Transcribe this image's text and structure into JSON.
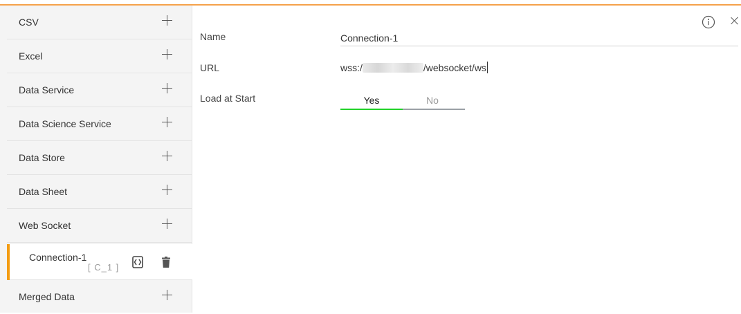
{
  "sidebar": {
    "items": [
      {
        "label": "CSV"
      },
      {
        "label": "Excel"
      },
      {
        "label": "Data Service"
      },
      {
        "label": "Data Science Service"
      },
      {
        "label": "Data Store"
      },
      {
        "label": "Data Sheet"
      },
      {
        "label": "Web Socket"
      }
    ],
    "connection": {
      "name": "Connection-1",
      "id": "[ C_1 ]"
    },
    "merged": {
      "label": "Merged Data"
    }
  },
  "form": {
    "name_label": "Name",
    "name_value": "Connection-1",
    "url_label": "URL",
    "url_prefix": "wss:/",
    "url_suffix": "/websocket/ws",
    "load_label": "Load at Start",
    "toggle_yes": "Yes",
    "toggle_no": "No",
    "toggle_selected": "Yes"
  },
  "colors": {
    "accent": "#f39c12",
    "toggle_on": "#22d22a"
  },
  "icons": {
    "info": "info-icon",
    "close": "close-icon",
    "add": "plus-icon",
    "edit": "script-icon",
    "delete": "trash-icon"
  }
}
